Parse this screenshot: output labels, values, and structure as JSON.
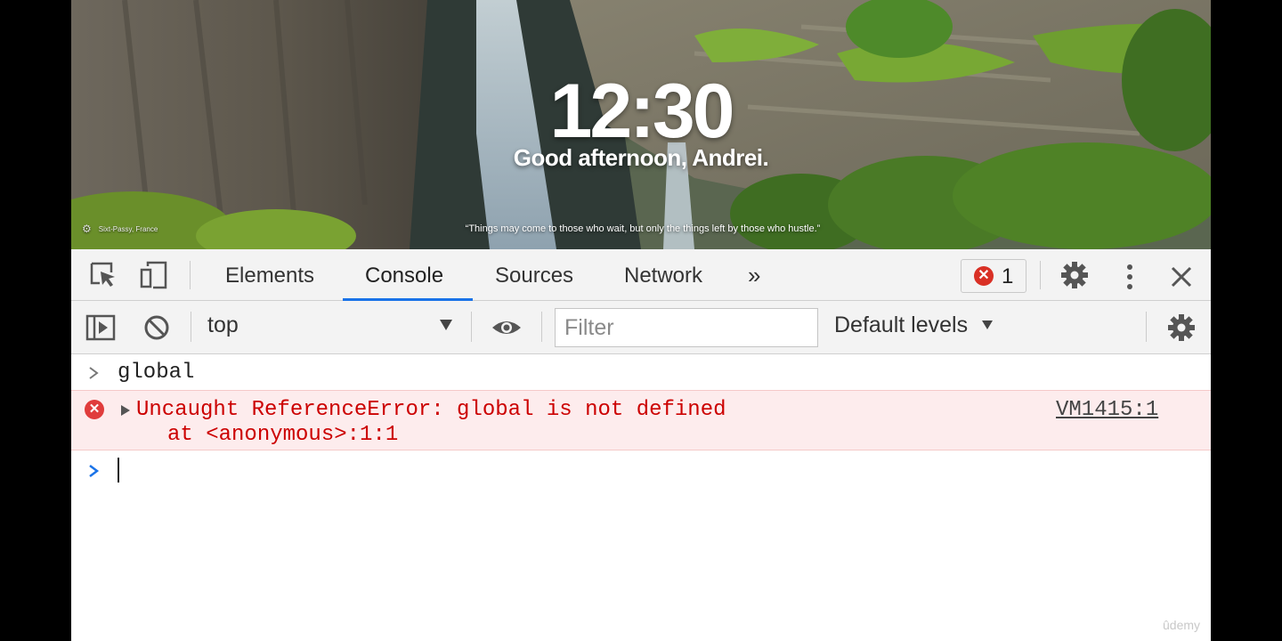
{
  "newtab": {
    "time": "12:30",
    "greeting": "Good afternoon, Andrei.",
    "quote": "“Things may come to those who wait, but only the things left by those who hustle.”",
    "location": "Sixt-Passy, France"
  },
  "devtools": {
    "tabs": [
      {
        "label": "Elements",
        "active": false
      },
      {
        "label": "Console",
        "active": true
      },
      {
        "label": "Sources",
        "active": false
      },
      {
        "label": "Network",
        "active": false
      }
    ],
    "more_tabs": "»",
    "error_count": "1",
    "console_toolbar": {
      "context": "top",
      "filter_placeholder": "Filter",
      "levels": "Default levels"
    },
    "console": {
      "input_command": "global",
      "error_line1": "Uncaught ReferenceError: global is not defined",
      "error_line2": "at <anonymous>:1:1",
      "error_source": "VM1415:1"
    },
    "colors": {
      "accent": "#1a73e8",
      "error": "#d93025",
      "error_bg": "#fdeced"
    }
  },
  "watermark": "ûdemy"
}
